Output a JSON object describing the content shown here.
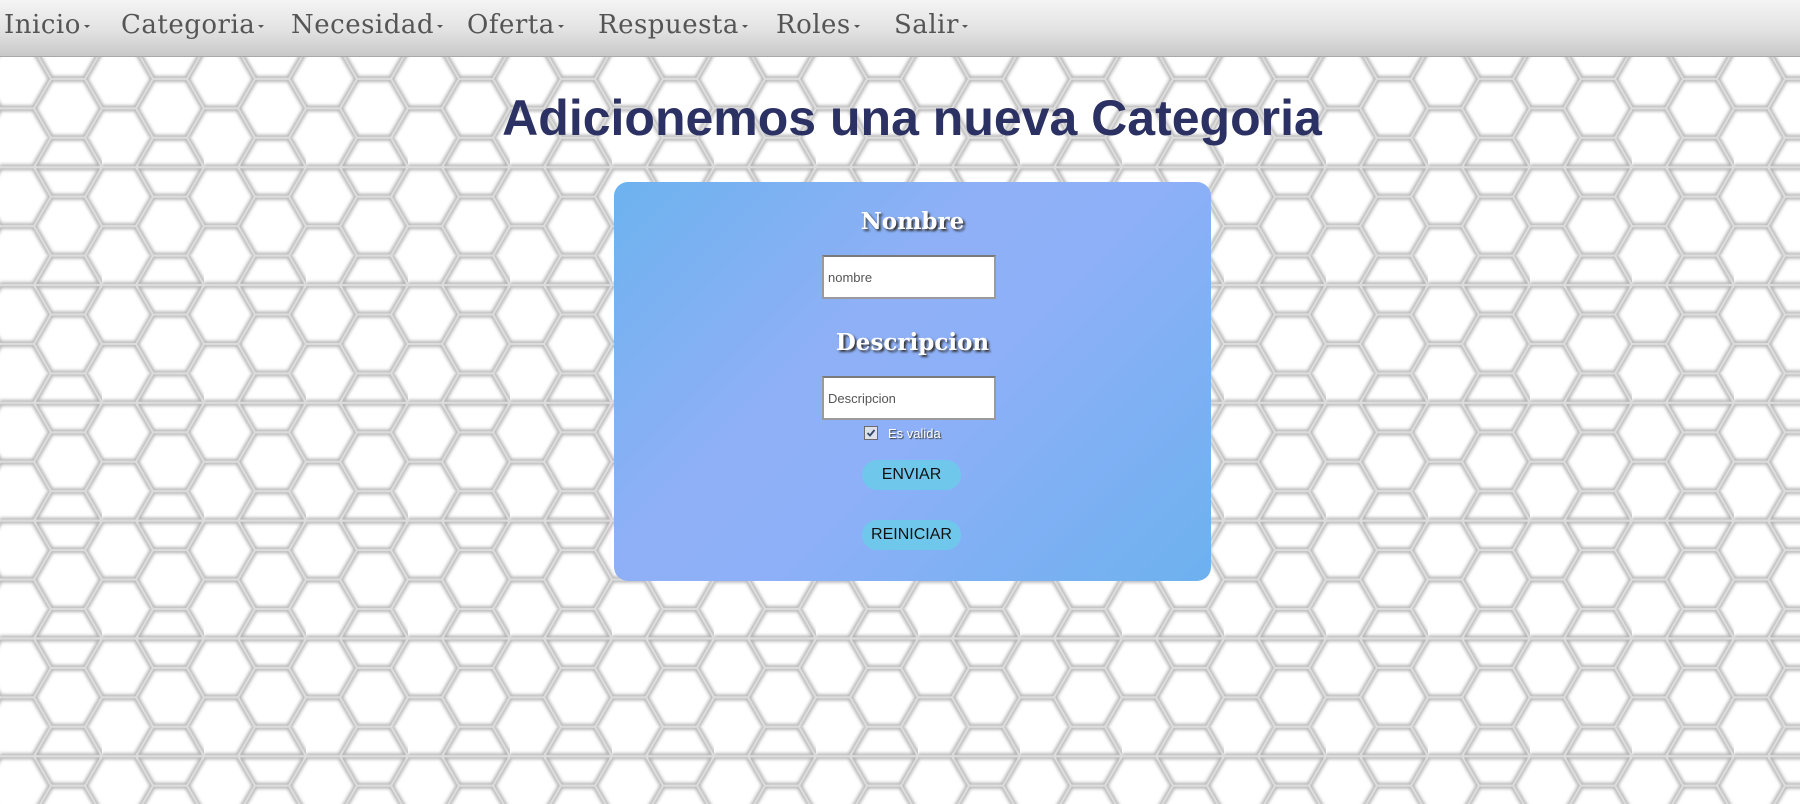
{
  "nav": {
    "items": [
      {
        "label": "Inicio"
      },
      {
        "label": "Categoria"
      },
      {
        "label": "Necesidad"
      },
      {
        "label": "Oferta"
      },
      {
        "label": "Respuesta"
      },
      {
        "label": "Roles"
      },
      {
        "label": "Salir"
      }
    ]
  },
  "page": {
    "title": "Adicionemos una nueva Categoria"
  },
  "form": {
    "nombre_label": "Nombre",
    "nombre_placeholder": "nombre",
    "nombre_value": "",
    "descripcion_label": "Descripcion",
    "descripcion_placeholder": "Descripcion",
    "descripcion_value": "",
    "checkbox_label": "Es valida",
    "checkbox_checked": true,
    "submit_label": "ENVIAR",
    "reset_label": "REINICIAR"
  },
  "colors": {
    "title": "#2b3162",
    "card_gradient_start": "#6db2ef",
    "card_gradient_mid": "#8fb0f6",
    "button": "#6fc8ec"
  },
  "icons": {
    "nav_caret": "caret-down-icon",
    "checkbox_check": "checkmark-icon"
  }
}
